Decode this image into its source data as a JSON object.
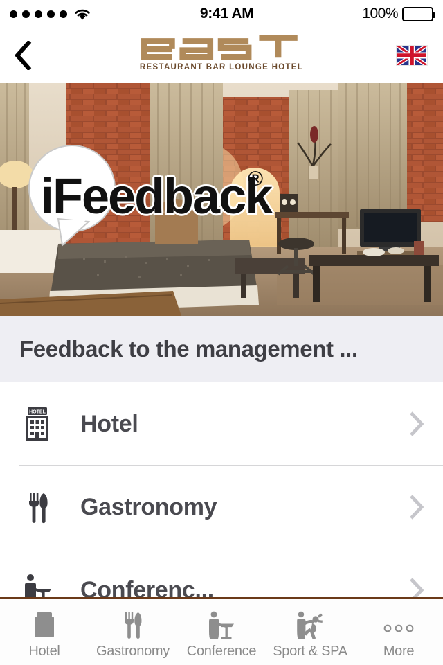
{
  "status_bar": {
    "signal_dots": 5,
    "signal_icon": "signal-dots-icon",
    "wifi_icon": "wifi-icon",
    "time": "9:41 AM",
    "battery_percent": "100%",
    "battery_icon": "battery-full-icon"
  },
  "nav_bar": {
    "back_icon": "chevron-left-icon",
    "brand_name": "east",
    "brand_tagline": "RESTAURANT BAR LOUNGE HOTEL",
    "brand_color": "#b08a5a",
    "tagline_color": "#6b4a2d",
    "language_flag": "union-jack-flag-icon",
    "language": "English"
  },
  "hero": {
    "image_alt": "hotel-room-photo",
    "logo_text_1": "iF",
    "logo_text": "iFeedback",
    "logo_trademark": "®",
    "bubble_icon": "speech-bubble-icon"
  },
  "section": {
    "title": "Feedback to the management ...",
    "background": "#eeeef3",
    "text_color": "#3e3e44"
  },
  "list": {
    "chevron_icon": "chevron-right-icon",
    "items": [
      {
        "label": "Hotel",
        "icon": "hotel-building-icon"
      },
      {
        "label": "Gastronomy",
        "icon": "fork-knife-icon"
      },
      {
        "label": "Conferenc...",
        "icon": "presenter-podium-icon"
      }
    ]
  },
  "tab_bar": {
    "border_color": "#6b3a19",
    "label_color": "#8a8a8a",
    "items": [
      {
        "label": "Hotel",
        "icon": "hotel-building-icon"
      },
      {
        "label": "Gastronomy",
        "icon": "fork-knife-icon"
      },
      {
        "label": "Conference",
        "icon": "presenter-podium-icon"
      },
      {
        "label": "Sport & SPA",
        "icon": "sport-spa-icon"
      },
      {
        "label": "More",
        "icon": "more-dots-icon"
      }
    ]
  }
}
